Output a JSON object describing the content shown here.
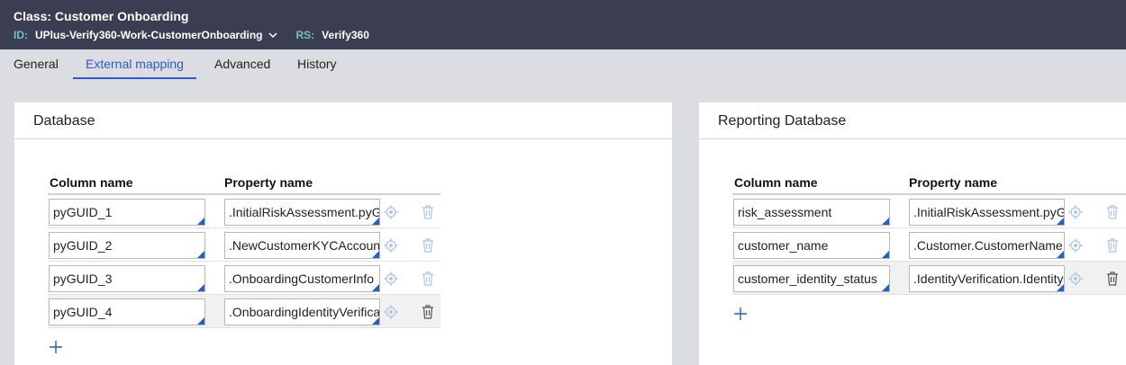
{
  "header": {
    "title": "Class: Customer Onboarding",
    "id_label": "ID:",
    "id_value": "UPlus-Verify360-Work-CustomerOnboarding",
    "rs_label": "RS:",
    "rs_value": "Verify360"
  },
  "tabs": [
    {
      "label": "General"
    },
    {
      "label": "External mapping"
    },
    {
      "label": "Advanced"
    },
    {
      "label": "History"
    }
  ],
  "database": {
    "title": "Database",
    "col_header": "Column name",
    "prop_header": "Property name",
    "rows": [
      {
        "column": "pyGUID_1",
        "property": ".InitialRiskAssessment.pyGUID"
      },
      {
        "column": "pyGUID_2",
        "property": ".NewCustomerKYCAccount"
      },
      {
        "column": "pyGUID_3",
        "property": ".OnboardingCustomerInfo"
      },
      {
        "column": "pyGUID_4",
        "property": ".OnboardingIdentityVerification"
      }
    ]
  },
  "reporting": {
    "title": "Reporting Database",
    "col_header": "Column name",
    "prop_header": "Property name",
    "rows": [
      {
        "column": "risk_assessment",
        "property": ".InitialRiskAssessment.pyGUID"
      },
      {
        "column": "customer_name",
        "property": ".Customer.CustomerName"
      },
      {
        "column": "customer_identity_status",
        "property": ".IdentityVerification.IdentityStatus"
      }
    ]
  },
  "colors": {
    "header_bg": "#3b3e52",
    "label_teal": "#6ec2c2",
    "accent": "#2d5bc9",
    "icon_blue": "#1f5fd6"
  },
  "icons": {
    "target": "crosshair-target-icon",
    "trash": "trash-icon",
    "plus": "plus-icon",
    "chevron": "chevron-down-icon"
  }
}
